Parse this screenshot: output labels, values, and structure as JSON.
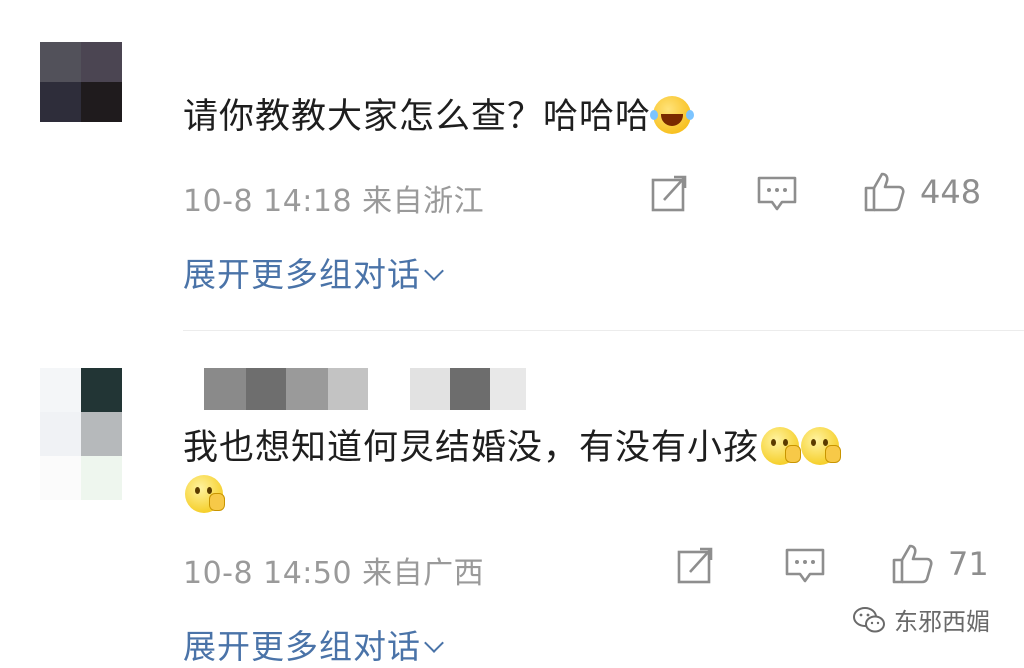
{
  "comments": [
    {
      "text": "请你教教大家怎么查？哈哈哈",
      "emojis": [
        "laugh-emoji"
      ],
      "meta": "10-8 14:18 来自浙江",
      "likes": "448",
      "expand_label": "展开更多组对话",
      "avatar_colors": [
        "#52515a",
        "#4b4552",
        "#2e2d3a",
        "#1f1b1d"
      ],
      "username_blur_colors": []
    },
    {
      "text_line1": "我也想知道何炅结婚没，有没有小孩",
      "emojis_line1": [
        "thinking-emoji",
        "thinking-emoji"
      ],
      "emojis_line2": [
        "thinking-emoji"
      ],
      "meta": "10-8 14:50 来自广西",
      "likes": "71",
      "expand_label": "展开更多组对话",
      "avatar_colors": [
        "#f4f6f8",
        "#223535",
        "#f0f2f5",
        "#b6b9bb",
        "#fbfbfb",
        "#eef6ee"
      ],
      "username_blur_colors": [
        "#8a8a8a",
        "#6e6e6e",
        "#9a9a9a",
        "#c3c3c3",
        "#ffffff",
        "#e2e2e2",
        "#6d6d6d",
        "#e8e8e8"
      ]
    }
  ],
  "watermark": "东邪西媚",
  "colors": {
    "link": "#4a73a8",
    "meta": "#9a9a9a",
    "text": "#1e1e1e"
  }
}
